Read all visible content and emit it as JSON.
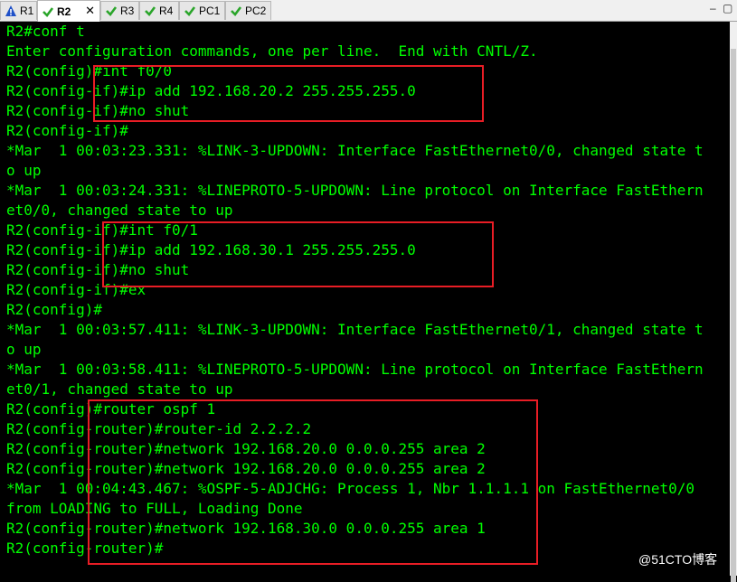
{
  "tabs": [
    {
      "label": "R1",
      "icon": "warning-icon",
      "active": false
    },
    {
      "label": "R2",
      "icon": "check-icon",
      "active": true
    },
    {
      "label": "R3",
      "icon": "check-icon",
      "active": false
    },
    {
      "label": "R4",
      "icon": "check-icon",
      "active": false
    },
    {
      "label": "PC1",
      "icon": "check-icon",
      "active": false
    },
    {
      "label": "PC2",
      "icon": "check-icon",
      "active": false
    }
  ],
  "window": {
    "min_symbol": "–",
    "max_symbol": "▢"
  },
  "colors": {
    "terminal_bg": "#000000",
    "terminal_text": "#00ff00",
    "highlight_box": "#e81d25",
    "warning": "#1e50c8",
    "check": "#2aa52a"
  },
  "terminal": {
    "lines": [
      "R2#conf t",
      "Enter configuration commands, one per line.  End with CNTL/Z.",
      "R2(config)#int f0/0",
      "R2(config-if)#ip add 192.168.20.2 255.255.255.0",
      "R2(config-if)#no shut",
      "R2(config-if)#",
      "*Mar  1 00:03:23.331: %LINK-3-UPDOWN: Interface FastEthernet0/0, changed state t",
      "o up",
      "*Mar  1 00:03:24.331: %LINEPROTO-5-UPDOWN: Line protocol on Interface FastEthern",
      "et0/0, changed state to up",
      "R2(config-if)#int f0/1",
      "R2(config-if)#ip add 192.168.30.1 255.255.255.0",
      "R2(config-if)#no shut",
      "R2(config-if)#ex",
      "R2(config)#",
      "*Mar  1 00:03:57.411: %LINK-3-UPDOWN: Interface FastEthernet0/1, changed state t",
      "o up",
      "*Mar  1 00:03:58.411: %LINEPROTO-5-UPDOWN: Line protocol on Interface FastEthern",
      "et0/1, changed state to up",
      "R2(config)#router ospf 1",
      "R2(config-router)#router-id 2.2.2.2",
      "R2(config-router)#network 192.168.20.0 0.0.0.255 area 2",
      "R2(config-router)#network 192.168.20.0 0.0.0.255 area 2",
      "*Mar  1 00:04:43.467: %OSPF-5-ADJCHG: Process 1, Nbr 1.1.1.1 on FastEthernet0/0",
      "from LOADING to FULL, Loading Done",
      "R2(config-router)#network 192.168.30.0 0.0.0.255 area 1",
      "R2(config-router)#"
    ]
  },
  "watermark": "@51CTO博客"
}
